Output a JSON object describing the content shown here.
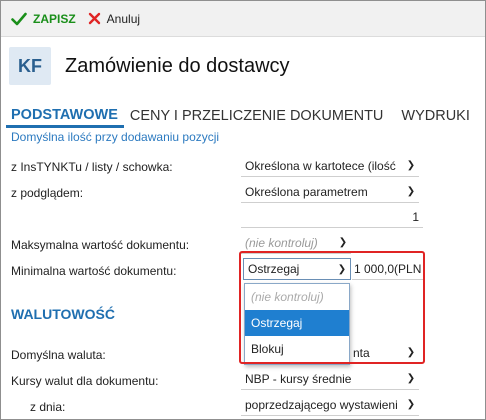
{
  "toolbar": {
    "save_label": "ZAPISZ",
    "cancel_label": "Anuluj"
  },
  "header": {
    "badge": "KF",
    "title": "Zamówienie do dostawcy"
  },
  "tabs": [
    {
      "label": "PODSTAWOWE"
    },
    {
      "label": "CENY I PRZELICZENIE DOKUMENTU"
    },
    {
      "label": "WYDRUKI"
    }
  ],
  "section_link": "Domyślna ilość przy dodawaniu pozycji",
  "fields": {
    "instynktu_label": "z InsTYNKTu / listy / schowka:",
    "instynktu_value": "Określona w kartotece (ilość",
    "podglad_label": "z podglądem:",
    "podglad_value": "Określona parametrem",
    "quantity_value": "1",
    "max_label": "Maksymalna wartość dokumentu:",
    "max_value": "(nie kontroluj)",
    "min_label": "Minimalna wartość dokumentu:",
    "min_value": "Ostrzegaj",
    "min_amount": "1 000,0(PLN"
  },
  "dropdown": {
    "options": [
      "(nie kontroluj)",
      "Ostrzegaj",
      "Blokuj"
    ],
    "selected": "Ostrzegaj"
  },
  "currency": {
    "heading": "WALUTOWOŚĆ",
    "default_label": "Domyślna waluta:",
    "default_value_partial": "nta",
    "rates_label": "Kursy walut dla dokumentu:",
    "rates_value": "NBP - kursy średnie",
    "day_label": "z dnia:",
    "day_value": "poprzedzającego wystawieni"
  },
  "colors": {
    "accent": "#1f6fb0",
    "save_green": "#1a8f1a",
    "cancel_red": "#e02424",
    "highlight": "#e02424"
  }
}
